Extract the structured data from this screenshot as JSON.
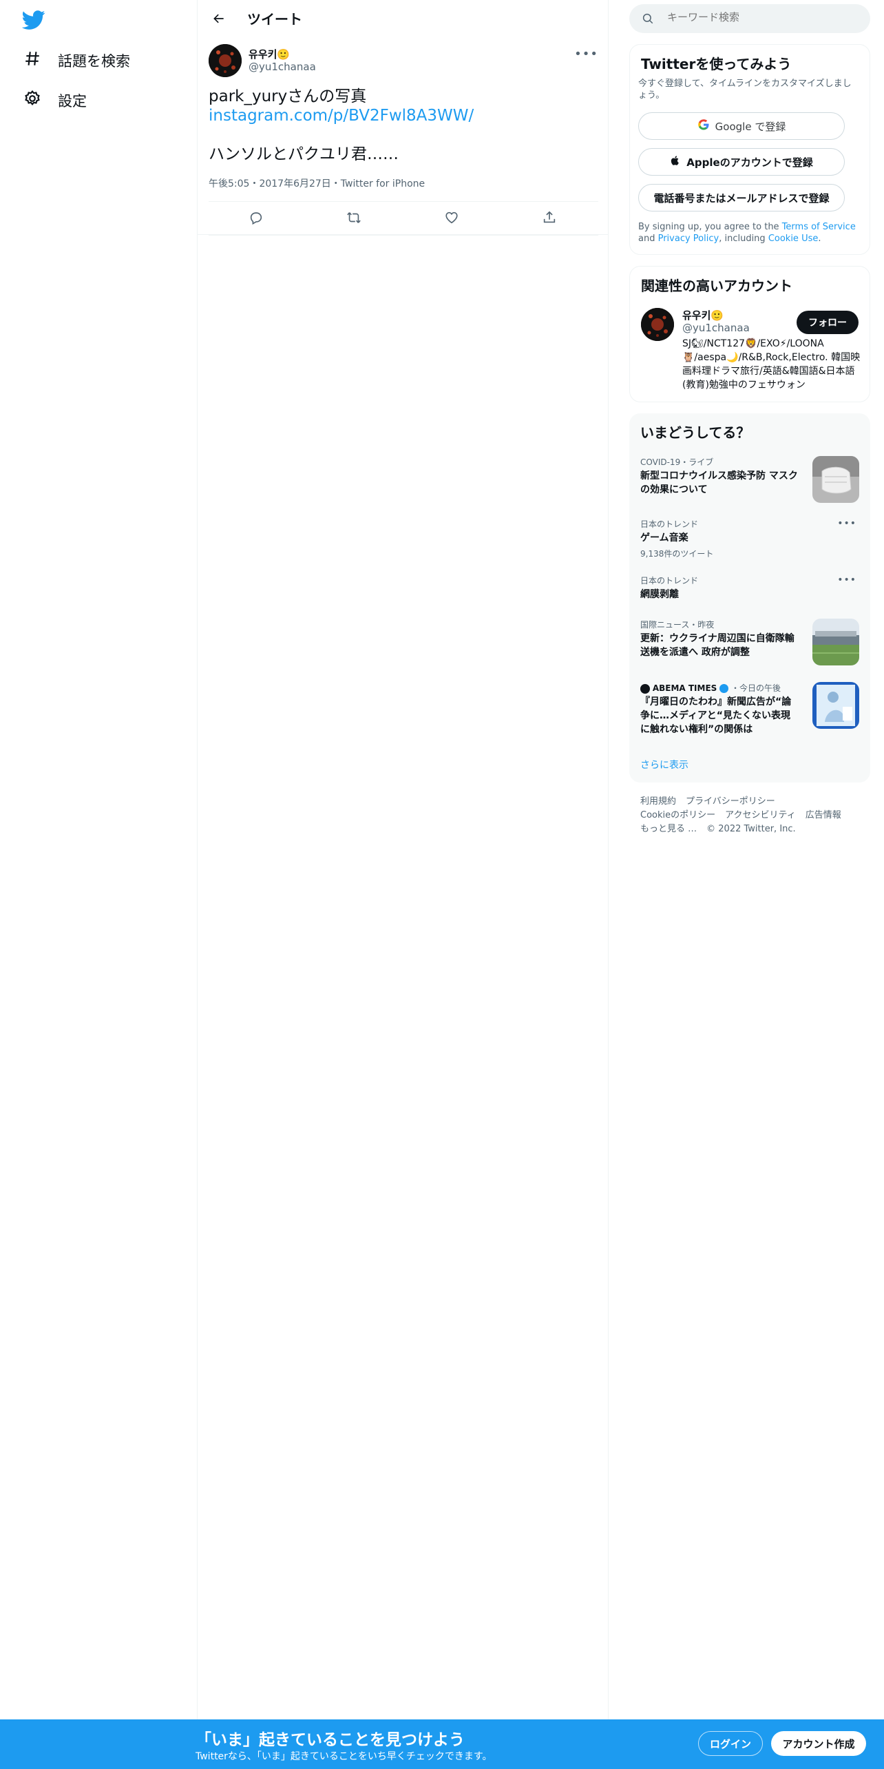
{
  "nav": {
    "explore_label": "話題を検索",
    "settings_label": "設定"
  },
  "header": {
    "title": "ツイート"
  },
  "tweet": {
    "author_name": "유우키🙂",
    "author_handle": "@yu1chanaa",
    "text_line1": "park_yuryさんの写真",
    "link": "instagram.com/p/BV2Fwl8A3WW/",
    "text_line3": "ハンソルとパクユリ君……",
    "meta": "午後5:05・2017年6月27日・Twitter for iPhone"
  },
  "search": {
    "placeholder": "キーワード検索"
  },
  "signup": {
    "title": "Twitterを使ってみよう",
    "subtitle": "今すぐ登録して、タイムラインをカスタマイズしましょう。",
    "google_label": "Google で登録",
    "apple_label": "Appleのアカウントで登録",
    "phone_label": "電話番号またはメールアドレスで登録",
    "terms_prefix": "By signing up, you agree to the ",
    "terms_link": "Terms of Service",
    "terms_and": " and ",
    "privacy_link": "Privacy Policy",
    "terms_including": ", including ",
    "cookie_link": "Cookie Use",
    "terms_end": "."
  },
  "related": {
    "title": "関連性の高いアカウント",
    "name": "유우키🙂",
    "handle": "@yu1chanaa",
    "follow_label": "フォロー",
    "bio": "SJ🐿/NCT127🦁/EXO⚡/LOONA🦉/aespa🌙/R&B,Rock,Electro. 韓国映画料理ドラマ旅行/英語&韓国語&日本語(教育)勉強中のフェサウォン"
  },
  "trends": {
    "title": "いまどうしてる？",
    "items": [
      {
        "meta": "COVID-19・ライブ",
        "title": "新型コロナウイルス感染予防 マスクの効果について",
        "count": ""
      },
      {
        "meta": "日本のトレンド",
        "title": "ゲーム音楽",
        "count": "9,138件のツイート"
      },
      {
        "meta": "日本のトレンド",
        "title": "網膜剥離",
        "count": ""
      },
      {
        "meta": "国際ニュース・昨夜",
        "title": "更新：ウクライナ周辺国に自衛隊輸送機を派遣へ 政府が調整",
        "count": ""
      },
      {
        "meta": "ABEMA TIMES",
        "meta_suffix": "・今日の午後",
        "title": "『月曜日のたわわ』新聞広告が“論争に…メディアと“見たくない表現に触れない権利”の関係は",
        "count": ""
      }
    ],
    "more_label": "さらに表示"
  },
  "footer": {
    "terms": "利用規約",
    "privacy": "プライバシーポリシー",
    "cookie": "Cookieのポリシー",
    "accessibility": "アクセシビリティ",
    "ads": "広告情報",
    "more": "もっと見る …",
    "copyright": "© 2022 Twitter, Inc."
  },
  "banner": {
    "title": "「いま」起きていることを見つけよう",
    "subtitle": "Twitterなら、「いま」起きていることをいち早くチェックできます。",
    "login_label": "ログイン",
    "signup_label": "アカウント作成"
  },
  "colors": {
    "brand": "#1d9bf0",
    "text": "#0f1419",
    "secondary": "#536471"
  }
}
